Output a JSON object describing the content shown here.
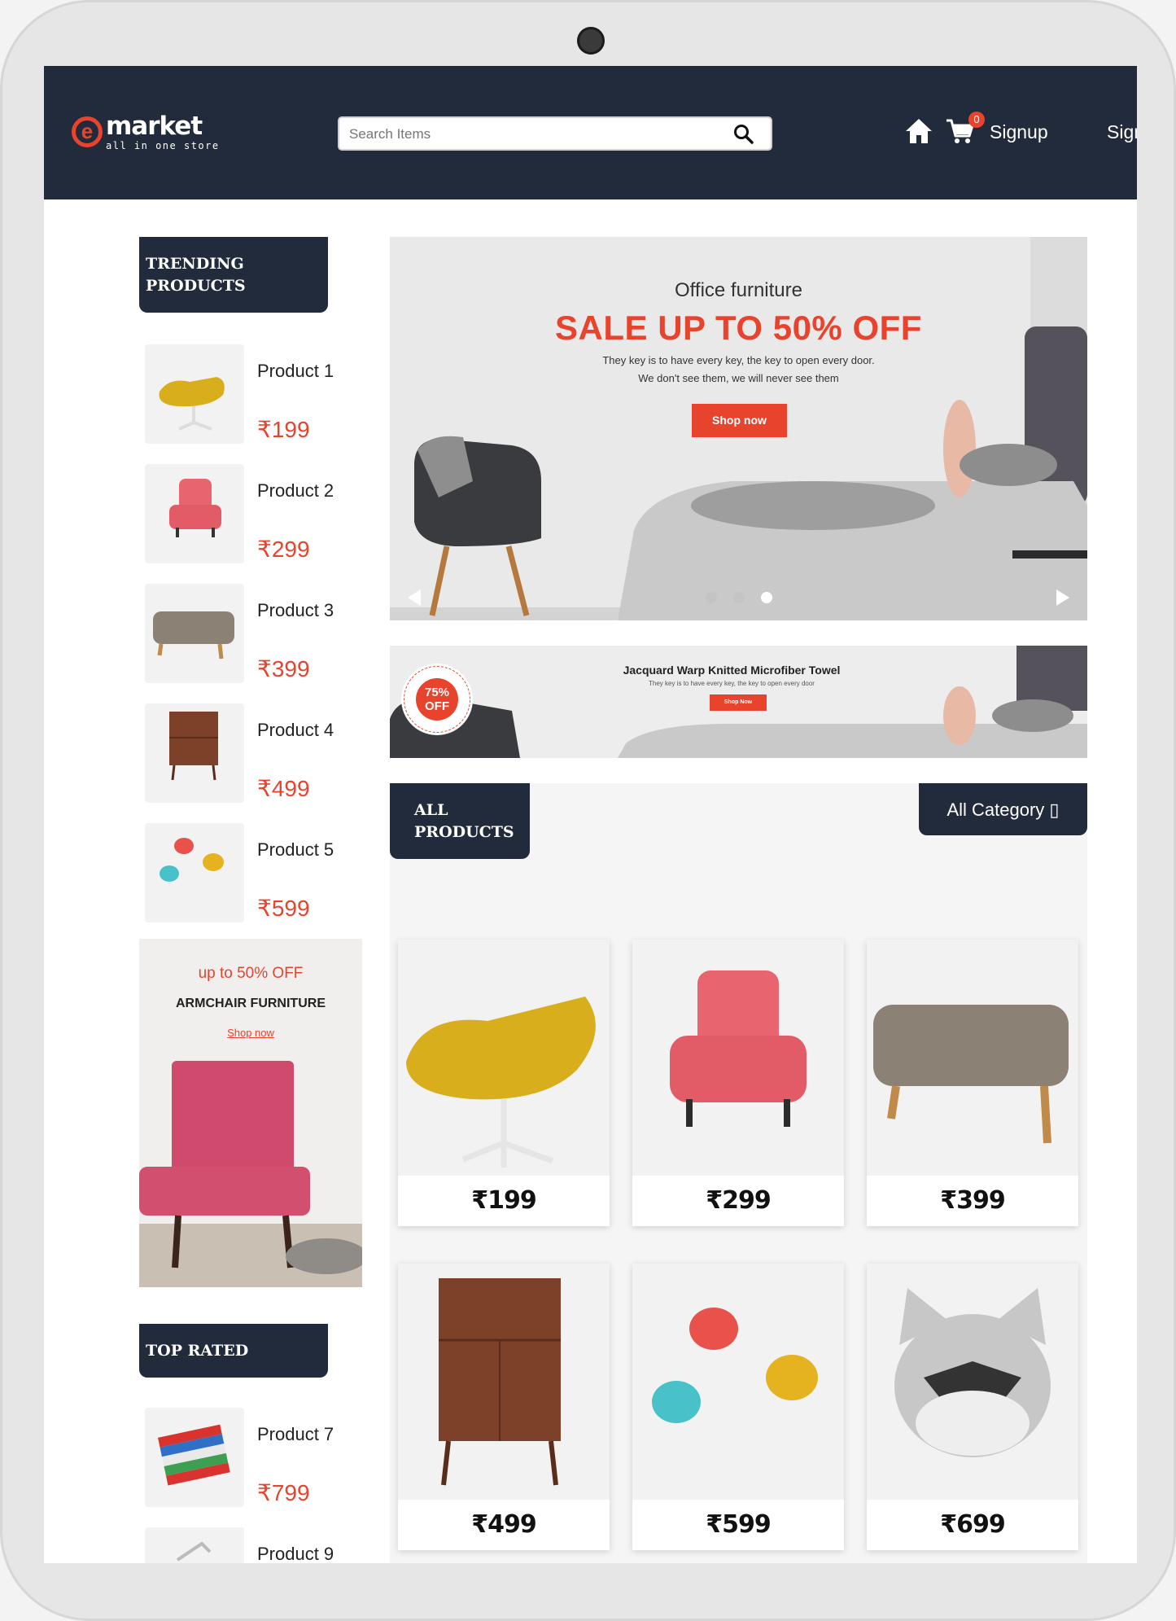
{
  "brand": {
    "name": "market",
    "tagline": "all in one store",
    "accent": "#e8432d",
    "dark": "#222b3b"
  },
  "search": {
    "placeholder": "Search Items"
  },
  "nav": {
    "cart_count": "0",
    "signup": "Signup",
    "signin": "Sign In",
    "home_icon": "home-icon",
    "cart_icon": "cart-icon"
  },
  "trending": {
    "title_line1": "TRENDING",
    "title_line2": "PRODUCTS",
    "items": [
      {
        "name": "Product 1",
        "price": "₹199"
      },
      {
        "name": "Product 2",
        "price": "₹299"
      },
      {
        "name": "Product 3",
        "price": "₹399"
      },
      {
        "name": "Product 4",
        "price": "₹499"
      },
      {
        "name": "Product 5",
        "price": "₹599"
      }
    ]
  },
  "promo": {
    "discount": "up to 50% OFF",
    "title": "ARMCHAIR FURNITURE",
    "link": "Shop now"
  },
  "top_rated": {
    "title": "TOP RATED",
    "items": [
      {
        "name": "Product 7",
        "price": "₹799"
      },
      {
        "name": "Product 9",
        "price": ""
      }
    ]
  },
  "hero": {
    "subtitle": "Office furniture",
    "title": "SALE UP TO 50% OFF",
    "line1": "They key is to have every key, the key to open every door.",
    "line2": "We don't see them, we will never see them",
    "button": "Shop now",
    "active_slide": 3,
    "slides": 3
  },
  "strip": {
    "badge_pct": "75%",
    "badge_off": "OFF",
    "title": "Jacquard Warp Knitted Microfiber Towel",
    "line": "They key is to have every key, the key to open every door",
    "button": "Shop Now"
  },
  "all_products": {
    "title_line1": "ALL",
    "title_line2": "PRODUCTS",
    "category": "All Category ▯",
    "items": [
      {
        "price": "₹199",
        "image": "yellow-chair"
      },
      {
        "price": "₹299",
        "image": "pink-armchair"
      },
      {
        "price": "₹399",
        "image": "ottoman"
      },
      {
        "price": "₹499",
        "image": "wooden-cabinet"
      },
      {
        "price": "₹599",
        "image": "bird-hooks"
      },
      {
        "price": "₹699",
        "image": "dog-pillow"
      }
    ]
  }
}
